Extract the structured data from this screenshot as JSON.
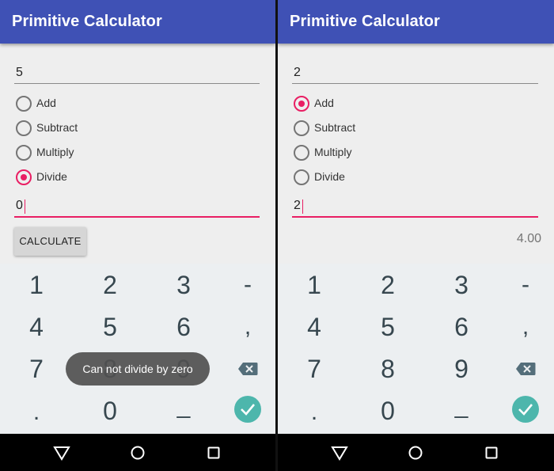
{
  "left": {
    "title": "Primitive Calculator",
    "first_operand": "5",
    "operations": [
      {
        "label": "Add",
        "checked": false
      },
      {
        "label": "Subtract",
        "checked": false
      },
      {
        "label": "Multiply",
        "checked": false
      },
      {
        "label": "Divide",
        "checked": true
      }
    ],
    "second_operand": "0",
    "calculate_label": "CALCULATE",
    "toast": "Can not divide by zero"
  },
  "right": {
    "title": "Primitive Calculator",
    "first_operand": "2",
    "operations": [
      {
        "label": "Add",
        "checked": true
      },
      {
        "label": "Subtract",
        "checked": false
      },
      {
        "label": "Multiply",
        "checked": false
      },
      {
        "label": "Divide",
        "checked": false
      }
    ],
    "second_operand": "2",
    "result": "4.00"
  },
  "keypad": {
    "keys": [
      "1",
      "2",
      "3",
      "-",
      "4",
      "5",
      "6",
      ",",
      "7",
      "8",
      "9",
      ".",
      "0",
      "_"
    ],
    "backspace_icon": "backspace-icon",
    "done_icon": "check-icon"
  },
  "navbar": {
    "icons": [
      "back-icon",
      "home-icon",
      "recents-icon"
    ]
  },
  "colors": {
    "appbar": "#3f51b5",
    "accent": "#e91e63",
    "done_key": "#4db6ac"
  }
}
